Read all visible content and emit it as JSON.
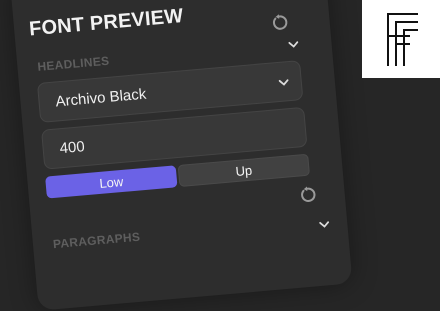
{
  "app": {
    "title": "FONT PREVIEW",
    "accent_color": "#6b62e6",
    "toggle_color": "#4a90e2",
    "toggle_on": true
  },
  "headlines": {
    "label": "HEADLINES",
    "font": "Archivo Black",
    "weight": "400",
    "case_options": [
      "Low",
      "Up"
    ],
    "selected_case": "Low"
  },
  "paragraphs": {
    "label": "PARAGRAPHS"
  },
  "icons": {
    "reset": "reset-icon",
    "chevron": "chevron-down-icon",
    "logo": "ff-logo"
  }
}
